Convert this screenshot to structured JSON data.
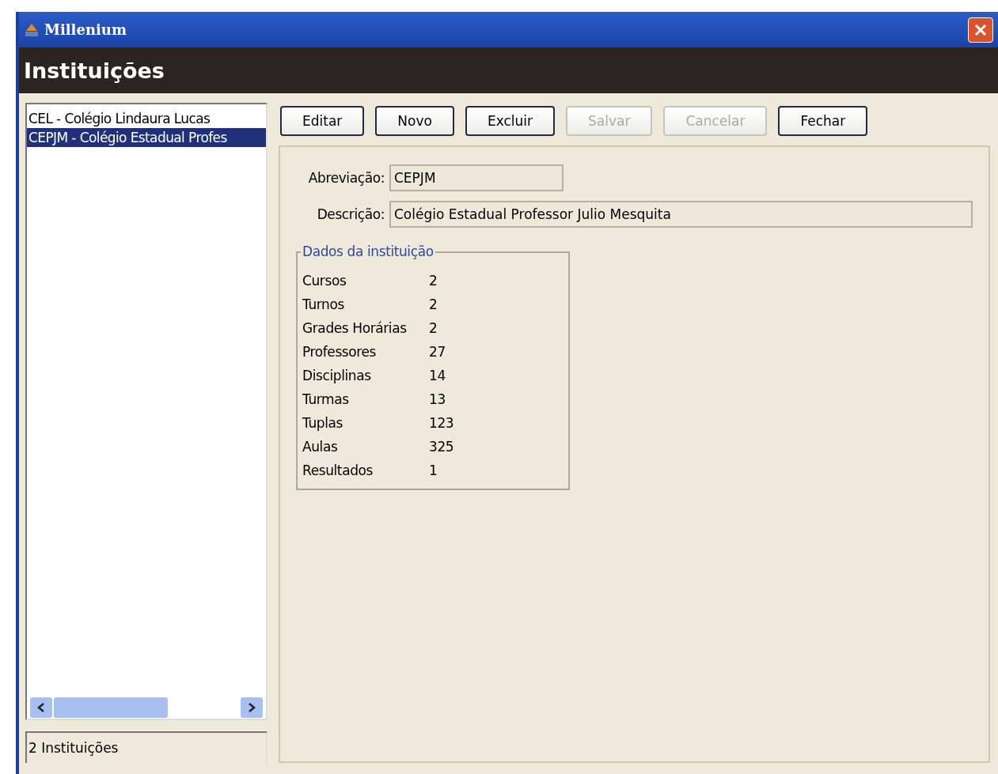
{
  "window": {
    "title": "Millenium"
  },
  "header": {
    "title": "Instituições"
  },
  "list": {
    "items": [
      {
        "label": "CEL - Colégio Lindaura Lucas",
        "selected": false
      },
      {
        "label": "CEPJM - Colégio Estadual Profes",
        "selected": true
      }
    ]
  },
  "status_bar": {
    "text": "2 Instituições"
  },
  "buttons": [
    {
      "label": "Editar",
      "disabled": false
    },
    {
      "label": "Novo",
      "disabled": false
    },
    {
      "label": "Excluir",
      "disabled": false
    },
    {
      "label": "Salvar",
      "disabled": true
    },
    {
      "label": "Cancelar",
      "disabled": true
    },
    {
      "label": "Fechar",
      "disabled": false
    }
  ],
  "form": {
    "fields": [
      {
        "label": "Abreviação:",
        "value": "CEPJM",
        "kind": "short"
      },
      {
        "label": "Descrição:",
        "value": "Colégio Estadual Professor Julio Mesquita",
        "kind": "wide"
      }
    ]
  },
  "stats": {
    "title": "Dados da instituição",
    "rows": [
      {
        "label": "Cursos",
        "value": "2"
      },
      {
        "label": "Turnos",
        "value": "2"
      },
      {
        "label": "Grades Horárias",
        "value": "2"
      },
      {
        "label": "Professores",
        "value": "27"
      },
      {
        "label": "Disciplinas",
        "value": "14"
      },
      {
        "label": "Turmas",
        "value": "13"
      },
      {
        "label": "Tuplas",
        "value": "123"
      },
      {
        "label": "Aulas",
        "value": "325"
      },
      {
        "label": "Resultados",
        "value": "1"
      }
    ]
  }
}
